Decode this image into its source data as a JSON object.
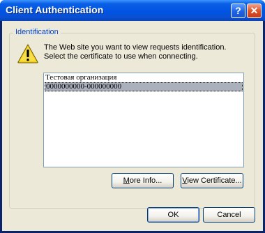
{
  "window": {
    "title": "Client Authentication"
  },
  "titlebar_buttons": {
    "help": "?",
    "close": "✕"
  },
  "group": {
    "label": "Identification"
  },
  "message": {
    "line1": "The Web site you want to view requests identification.",
    "line2": "Select the certificate to use when connecting."
  },
  "certificates": {
    "items": [
      {
        "label": "Тестовая организация",
        "selected": false
      },
      {
        "label": "0000000000-000000000",
        "selected": true
      }
    ]
  },
  "buttons": {
    "more_info_mnemonic": "M",
    "more_info_rest": "ore Info...",
    "view_cert_mnemonic": "V",
    "view_cert_rest": "iew Certificate...",
    "ok": "OK",
    "cancel": "Cancel"
  },
  "colors": {
    "titlebar": "#0054e3",
    "dialog_bg": "#ece9d8",
    "group_label": "#0046d5",
    "selection": "#aab0bc"
  },
  "icons": {
    "warning": "warning-icon",
    "help": "help-icon",
    "close": "close-icon"
  }
}
